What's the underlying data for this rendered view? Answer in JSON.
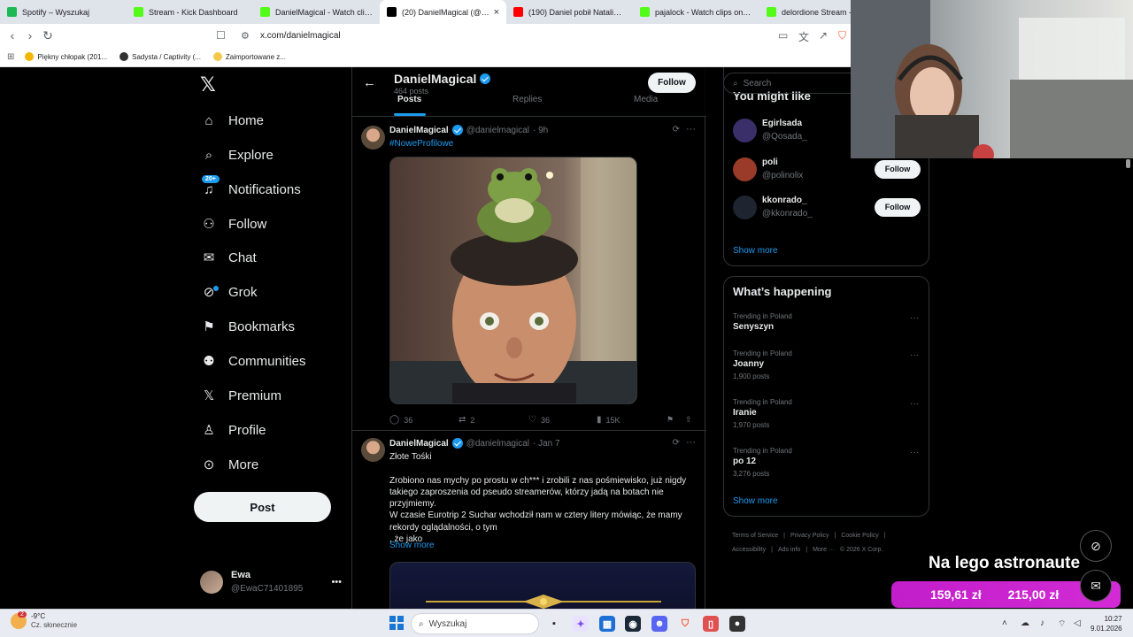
{
  "browser": {
    "tabs": [
      {
        "title": "Spotify – Wyszukaj",
        "icon": "spotify-icon",
        "color": "#1db954"
      },
      {
        "title": "Stream - Kick Dashboard",
        "icon": "kick-icon",
        "color": "#53fc18"
      },
      {
        "title": "DanielMagical - Watch clips on",
        "icon": "kick-icon",
        "color": "#53fc18"
      },
      {
        "title": "(20) DanielMagical (@dan",
        "icon": "x-icon",
        "color": "#000000",
        "active": true
      },
      {
        "title": "(190) Daniel pobił Natalie , ca",
        "icon": "youtube-icon",
        "color": "#ff0000"
      },
      {
        "title": "pajalock - Watch clips on Kick",
        "icon": "kick-icon",
        "color": "#53fc18"
      },
      {
        "title": "delordione Stream - W",
        "icon": "kick-icon",
        "color": "#53fc18"
      }
    ],
    "url": "x.com/danielmagical",
    "bookmarks": [
      {
        "label": "Piękny chłopak (201...",
        "color": "#f4b400"
      },
      {
        "label": "Sadysta / Captivity (...",
        "color": "#333333"
      },
      {
        "label": "Zaimportowane z...",
        "color": "#f2c94c"
      }
    ]
  },
  "nav": {
    "items": [
      {
        "label": "Home",
        "icon": "home-icon"
      },
      {
        "label": "Explore",
        "icon": "search-icon"
      },
      {
        "label": "Notifications",
        "icon": "bell-icon",
        "badge": "20+"
      },
      {
        "label": "Follow",
        "icon": "follow-icon"
      },
      {
        "label": "Chat",
        "icon": "mail-icon"
      },
      {
        "label": "Grok",
        "icon": "grok-icon"
      },
      {
        "label": "Bookmarks",
        "icon": "bookmark-icon"
      },
      {
        "label": "Communities",
        "icon": "communities-icon"
      },
      {
        "label": "Premium",
        "icon": "x-icon"
      },
      {
        "label": "Profile",
        "icon": "person-icon"
      },
      {
        "label": "More",
        "icon": "more-circle-icon"
      }
    ],
    "post_label": "Post",
    "account": {
      "name": "Ewa",
      "handle": "@EwaC71401895"
    }
  },
  "profile": {
    "name": "DanielMagical",
    "posts_count": "464 posts",
    "follow_label": "Follow",
    "tabs": [
      "Posts",
      "Replies",
      "Media"
    ]
  },
  "posts": [
    {
      "author": "DanielMagical",
      "handle": "@danielmagical",
      "time": "· 9h",
      "text": "#NoweProfilowe",
      "replies": "36",
      "reposts": "2",
      "likes": "36",
      "views": "15K"
    },
    {
      "author": "DanielMagical",
      "handle": "@danielmagical",
      "time": "· Jan 7",
      "lines": [
        "Złote Tośki",
        "",
        "Zrobiono nas mychy po prostu w ch*** i zrobili z nas pośmiewisko, już nigdy",
        "takiego zaproszenia od pseudo streamerów, którzy jadą na botach nie",
        "przyjmiemy.",
        "W czasie Eurotrip 2 Suchar wchodził nam w cztery litery mówiąc, że mamy",
        "rekordy oglądalności, o tym",
        ", że jako"
      ],
      "show_more": "Show more"
    }
  ],
  "sidebar": {
    "search_placeholder": "Search",
    "who_title": "You might like",
    "who": [
      {
        "name": "Egirlsada",
        "handle": "@Qosada_",
        "avatar": "#3b2f6a"
      },
      {
        "name": "poli",
        "handle": "@polinolix",
        "avatar": "#9a3b2a"
      },
      {
        "name": "kkonrado_",
        "handle": "@kkonrado_",
        "avatar": "#1e2430"
      }
    ],
    "follow_label": "Follow",
    "show_more": "Show more",
    "trends_title": "What’s happening",
    "trends": [
      {
        "context": "Trending in Poland",
        "name": "Senyszyn",
        "posts": ""
      },
      {
        "context": "Trending in Poland",
        "name": "Joanny",
        "posts": "1,900 posts"
      },
      {
        "context": "Trending in Poland",
        "name": "Iranie",
        "posts": "1,970 posts"
      },
      {
        "context": "Trending in Poland",
        "name": "po 12",
        "posts": "3,276 posts"
      }
    ],
    "footer": [
      "Terms of Service",
      "|",
      "Privacy Policy",
      "|",
      "Cookie Policy",
      "|",
      "Accessibility",
      "|",
      "Ads info",
      "|",
      "More ···",
      "© 2026 X Corp."
    ]
  },
  "overlay": {
    "title": "Na lego astronaute",
    "amount1": "159,61 zł",
    "amount2": "215,00 zł"
  },
  "taskbar": {
    "weather_temp": "-9°C",
    "weather_desc": "Cz. słonecznie",
    "weather_badge": "2",
    "search_placeholder": "Wyszukaj",
    "time": "10:27",
    "date": "9.01.2026"
  }
}
